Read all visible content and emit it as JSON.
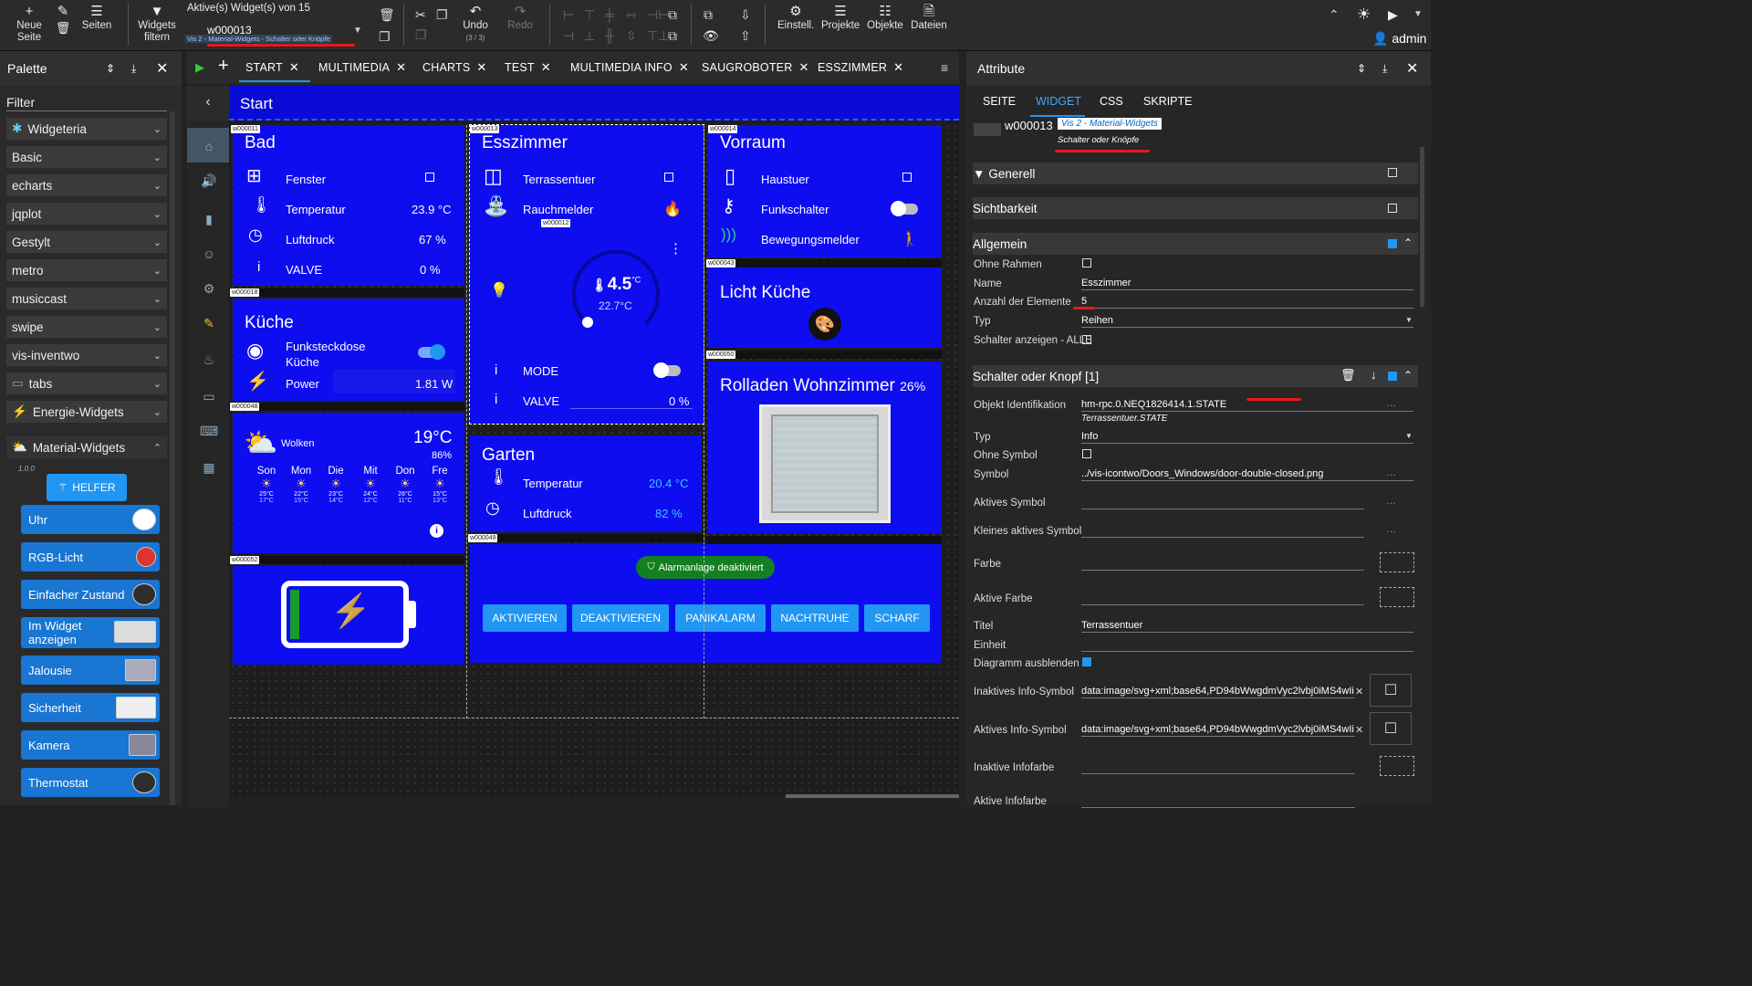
{
  "toolbar": {
    "new_page": "Neue Seite",
    "pages": "Seiten",
    "widgets_filter": "Widgets filtern",
    "active_widget": "Aktive(s) Widget(s) von 15",
    "widget_id": "w000013",
    "widget_sub": "Vis 2 - Material-Widgets - Schalter oder Knöpfe",
    "undo": "Undo",
    "undo_count": "(3 / 3)",
    "redo": "Redo",
    "settings": "Einstell.",
    "projects": "Projekte",
    "objects": "Objekte",
    "files": "Dateien",
    "user": "admin"
  },
  "palette": {
    "title": "Palette",
    "filter": "Filter",
    "categories": [
      "Widgeteria",
      "Basic",
      "echarts",
      "jqplot",
      "Gestylt",
      "metro",
      "musiccast",
      "swipe",
      "vis-inventwo",
      "tabs",
      "Energie-Widgets"
    ],
    "material": "Material-Widgets",
    "version": "1.0.0",
    "helper": "HELFER",
    "widgets": [
      "Uhr",
      "RGB-Licht",
      "Einfacher Zustand",
      "Im Widget anzeigen",
      "Jalousie",
      "Sicherheit",
      "Kamera",
      "Thermostat"
    ]
  },
  "tabs": [
    "START",
    "MULTIMEDIA",
    "CHARTS",
    "TEST",
    "MULTIMEDIA INFO",
    "SAUGROBOTER",
    "ESSZIMMER"
  ],
  "canvas": {
    "page_title": "Start",
    "bad": {
      "title": "Bad",
      "rows": [
        {
          "label": "Fenster",
          "value": ""
        },
        {
          "label": "Temperatur",
          "value": "23.9 °C"
        },
        {
          "label": "Luftdruck",
          "value": "67 %"
        },
        {
          "label": "VALVE",
          "value": "0 %"
        }
      ],
      "id": "w000011",
      "id2": "w000018",
      "count": "1",
      "count2": "5"
    },
    "kueche": {
      "title": "Küche",
      "rows": [
        {
          "label": "Funksteckdose Küche"
        },
        {
          "label": "Power",
          "value": "1.81 W"
        }
      ],
      "id": "w000048",
      "count": "9"
    },
    "esszimmer": {
      "title": "Esszimmer",
      "rows": [
        {
          "label": "Terrassentuer"
        },
        {
          "label": "Rauchmelder"
        },
        {
          "label": "MODE"
        },
        {
          "label": "VALVE",
          "value": "0 %"
        }
      ],
      "thermo_set": "4.5",
      "thermo_unit": "°C",
      "thermo_actual": "22.7°C",
      "id": "w000013",
      "id_sub": "w000012",
      "count": "2"
    },
    "vorraum": {
      "title": "Vorraum",
      "rows": [
        {
          "label": "Haustuer"
        },
        {
          "label": "Funkschalter"
        },
        {
          "label": "Bewegungsmelder"
        }
      ],
      "id": "w000014",
      "id2": "w000043",
      "count": "3",
      "count2": "7"
    },
    "licht": {
      "title": "Licht Küche",
      "id": "w000050",
      "count": "11"
    },
    "rolladen": {
      "title": "Rolladen Wohnzimmer",
      "value": "26%",
      "count": "10"
    },
    "wetter": {
      "label": "Wolken",
      "temp": "19°C",
      "hum": "86%",
      "days": [
        {
          "d": "Son",
          "hi": "25°C",
          "lo": "17°C"
        },
        {
          "d": "Mon",
          "hi": "22°C",
          "lo": "15°C"
        },
        {
          "d": "Die",
          "hi": "23°C",
          "lo": "14°C"
        },
        {
          "d": "Mit",
          "hi": "24°C",
          "lo": "12°C"
        },
        {
          "d": "Don",
          "hi": "26°C",
          "lo": "11°C"
        },
        {
          "d": "Fre",
          "hi": "15°C",
          "lo": "13°C"
        }
      ],
      "id": "w000052",
      "count": "13"
    },
    "garten": {
      "title": "Garten",
      "rows": [
        {
          "label": "Temperatur",
          "value": "20.4 °C"
        },
        {
          "label": "Luftdruck",
          "value": "82 %"
        }
      ],
      "id": "w000049"
    },
    "alarm": {
      "status": "Alarmanlage deaktiviert",
      "buttons": [
        "AKTIVIEREN",
        "DEAKTIVIEREN",
        "PANIKALARM",
        "NACHTRUHE",
        "SCHARF"
      ]
    }
  },
  "attributes": {
    "title": "Attribute",
    "tabs": [
      "SEITE",
      "WIDGET",
      "CSS",
      "SKRIPTE"
    ],
    "widget_id": "w000013",
    "set": "Vis 2 - Material-Widgets",
    "set_sub": "Schalter oder Knöpfe",
    "sections": {
      "generell": "Generell",
      "sichtbarkeit": "Sichtbarkeit",
      "allgemein": "Allgemein",
      "schalter": "Schalter oder Knopf [1]"
    },
    "allgemein": [
      {
        "label": "Ohne Rahmen",
        "value": ""
      },
      {
        "label": "Name",
        "value": "Esszimmer"
      },
      {
        "label": "Anzahl der Elemente",
        "value": "5"
      },
      {
        "label": "Typ",
        "value": "Reihen"
      },
      {
        "label": "Schalter anzeigen - ALLE",
        "value": ""
      }
    ],
    "schalter": [
      {
        "label": "Objekt Identifikation",
        "value": "hm-rpc.0.NEQ1826414.1.STATE",
        "sub": "Terrassentuer.STATE"
      },
      {
        "label": "Typ",
        "value": "Info"
      },
      {
        "label": "Ohne Symbol",
        "value": ""
      },
      {
        "label": "Symbol",
        "value": "../vis-icontwo/Doors_Windows/door-double-closed.png"
      },
      {
        "label": "Aktives Symbol",
        "value": ""
      },
      {
        "label": "Kleines aktives Symbol",
        "value": ""
      },
      {
        "label": "Farbe",
        "value": ""
      },
      {
        "label": "Aktive Farbe",
        "value": ""
      },
      {
        "label": "Titel",
        "value": "Terrassentuer"
      },
      {
        "label": "Einheit",
        "value": ""
      },
      {
        "label": "Diagramm ausblenden",
        "value": ""
      },
      {
        "label": "Inaktives Info-Symbol",
        "value": "data:image/svg+xml;base64,PD94bWwgdmVyc2lvbj0iMS4wIi"
      },
      {
        "label": "Aktives Info-Symbol",
        "value": "data:image/svg+xml;base64,PD94bWwgdmVyc2lvbj0iMS4wIi"
      },
      {
        "label": "Inaktive Infofarbe",
        "value": ""
      },
      {
        "label": "Aktive Infofarbe",
        "value": ""
      }
    ]
  }
}
